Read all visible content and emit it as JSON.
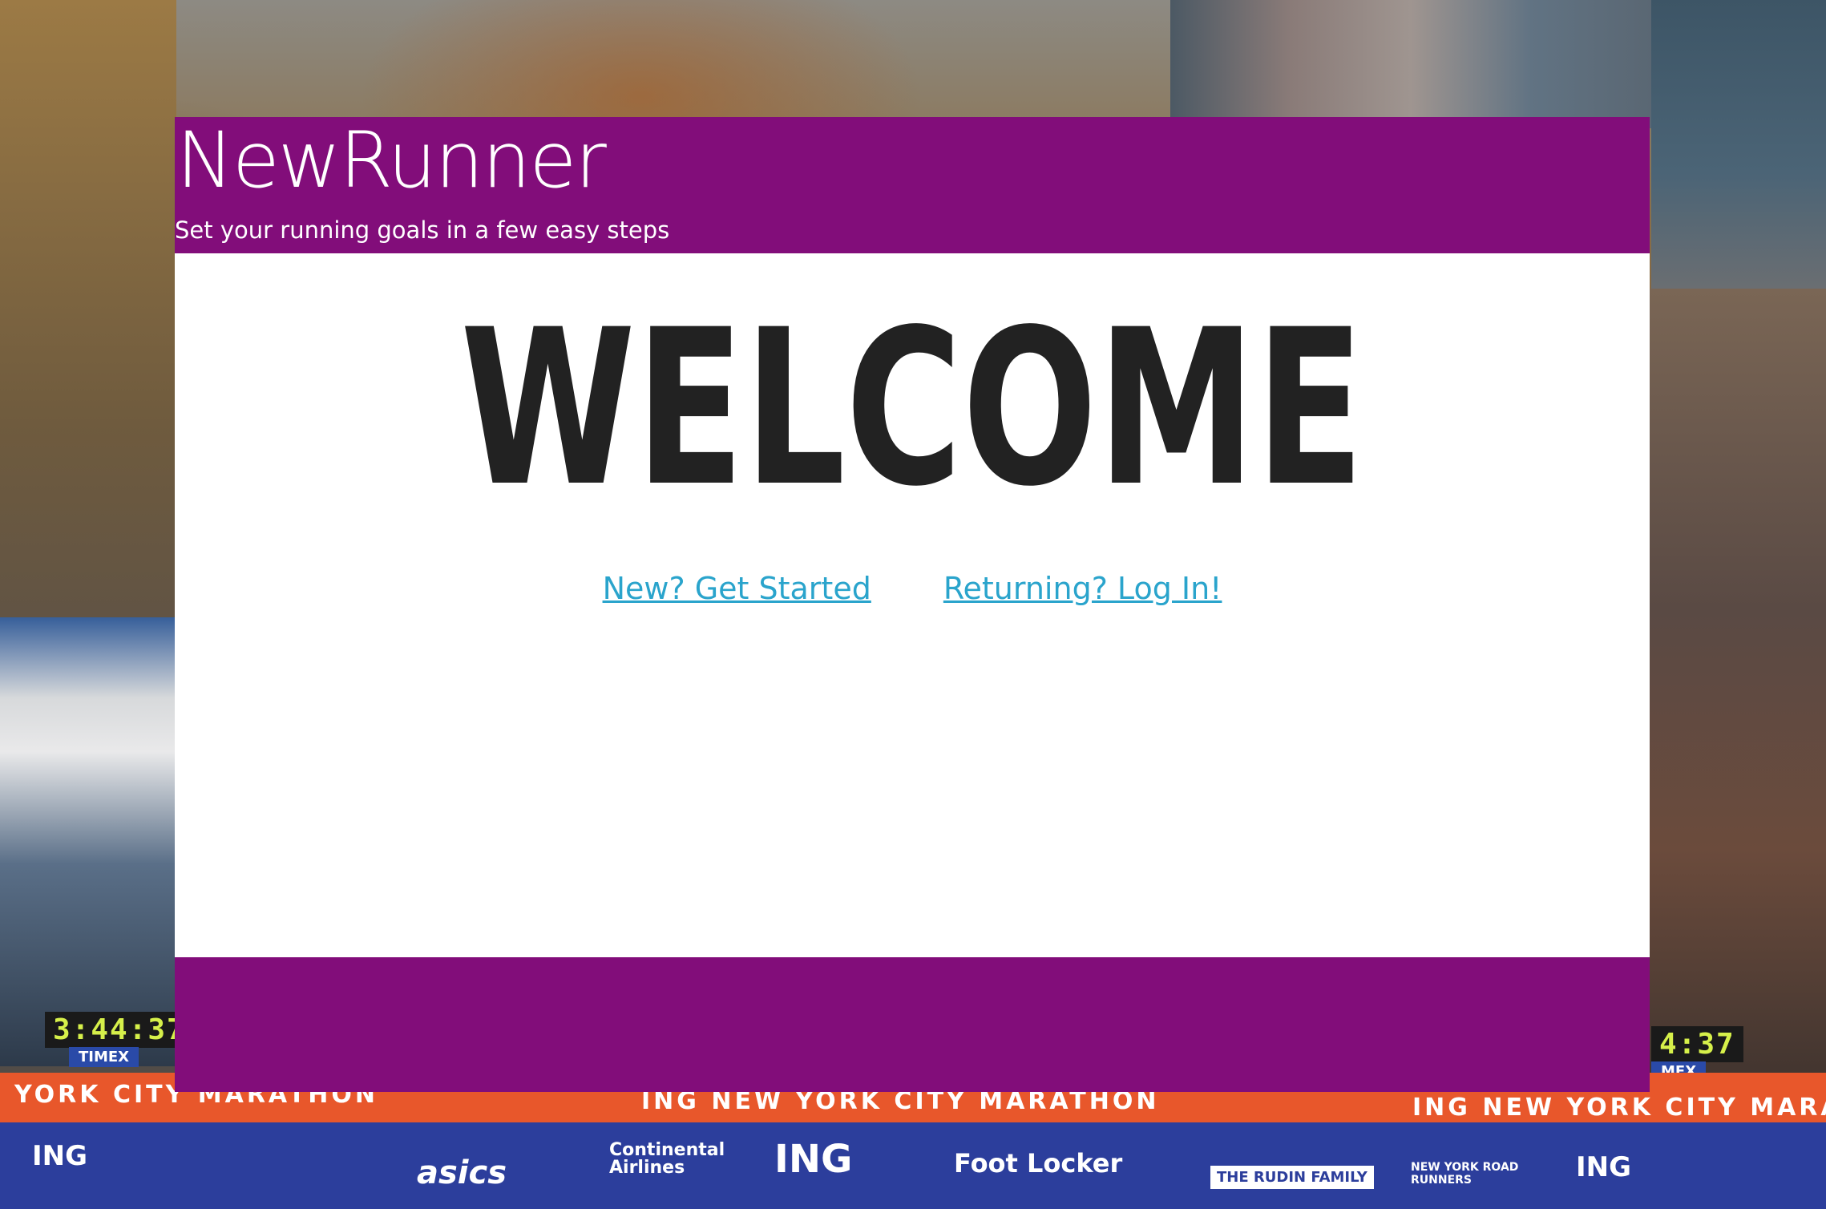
{
  "header": {
    "brand": "NewRunner",
    "tagline": "Set your running goals in a few easy steps"
  },
  "main": {
    "heading": "WELCOME",
    "links": [
      {
        "label": "New? Get Started"
      },
      {
        "label": "Returning? Log In!"
      }
    ]
  },
  "background": {
    "banner_left": "YORK CITY MARATHON",
    "banner_center": "ING NEW YORK CITY MARATHON",
    "banner_right": "ING NEW YORK CITY MARA",
    "clock_left": "3:44:37",
    "clock_left_brand": "TIMEX",
    "clock_right": "4:37",
    "clock_right_brand": "MEX",
    "sponsors": [
      "ING",
      "asics",
      "Continental Airlines",
      "ING",
      "Foot Locker",
      "THE RUDIN FAMILY",
      "NEW YORK ROAD RUNNERS",
      "ING"
    ]
  },
  "colors": {
    "header_bg": "#820d7a",
    "footer_bg": "#820d7a",
    "link": "#2aa4cc",
    "heading": "#222222"
  }
}
